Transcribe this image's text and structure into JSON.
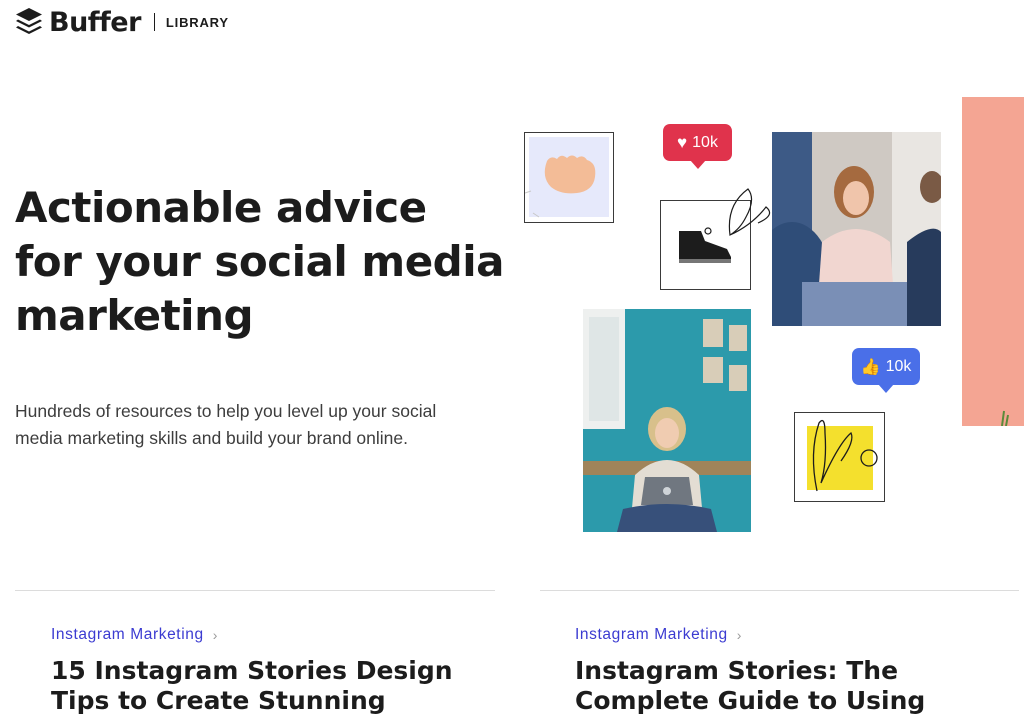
{
  "header": {
    "brand": "Buffer",
    "section": "LIBRARY"
  },
  "hero": {
    "title": "Actionable advice for your social media marketing",
    "subtitle": "Hundreds of resources to help you level up your social media marketing skills and build your brand online."
  },
  "collage": {
    "heart_badge": {
      "icon": "heart-icon",
      "count": "10k",
      "color": "#e0334c"
    },
    "like_badge": {
      "icon": "thumbs-up-icon",
      "count": "10k",
      "color": "#4a6fe8"
    },
    "images": [
      "hand-illustration",
      "sneaker-illustration",
      "woman-at-meeting-photo",
      "woman-with-laptop-photo",
      "yellow-square-illustration",
      "peach-panel"
    ]
  },
  "articles": [
    {
      "category": "Instagram Marketing",
      "title": "15 Instagram Stories Design\nTips to Create Stunning"
    },
    {
      "category": "Instagram Marketing",
      "title": "Instagram Stories: The\nComplete Guide to Using"
    }
  ],
  "colors": {
    "accent": "#3b3bd1",
    "text": "#1c1c1c",
    "peach": "#f4a593",
    "yellow": "#f4e02d"
  }
}
